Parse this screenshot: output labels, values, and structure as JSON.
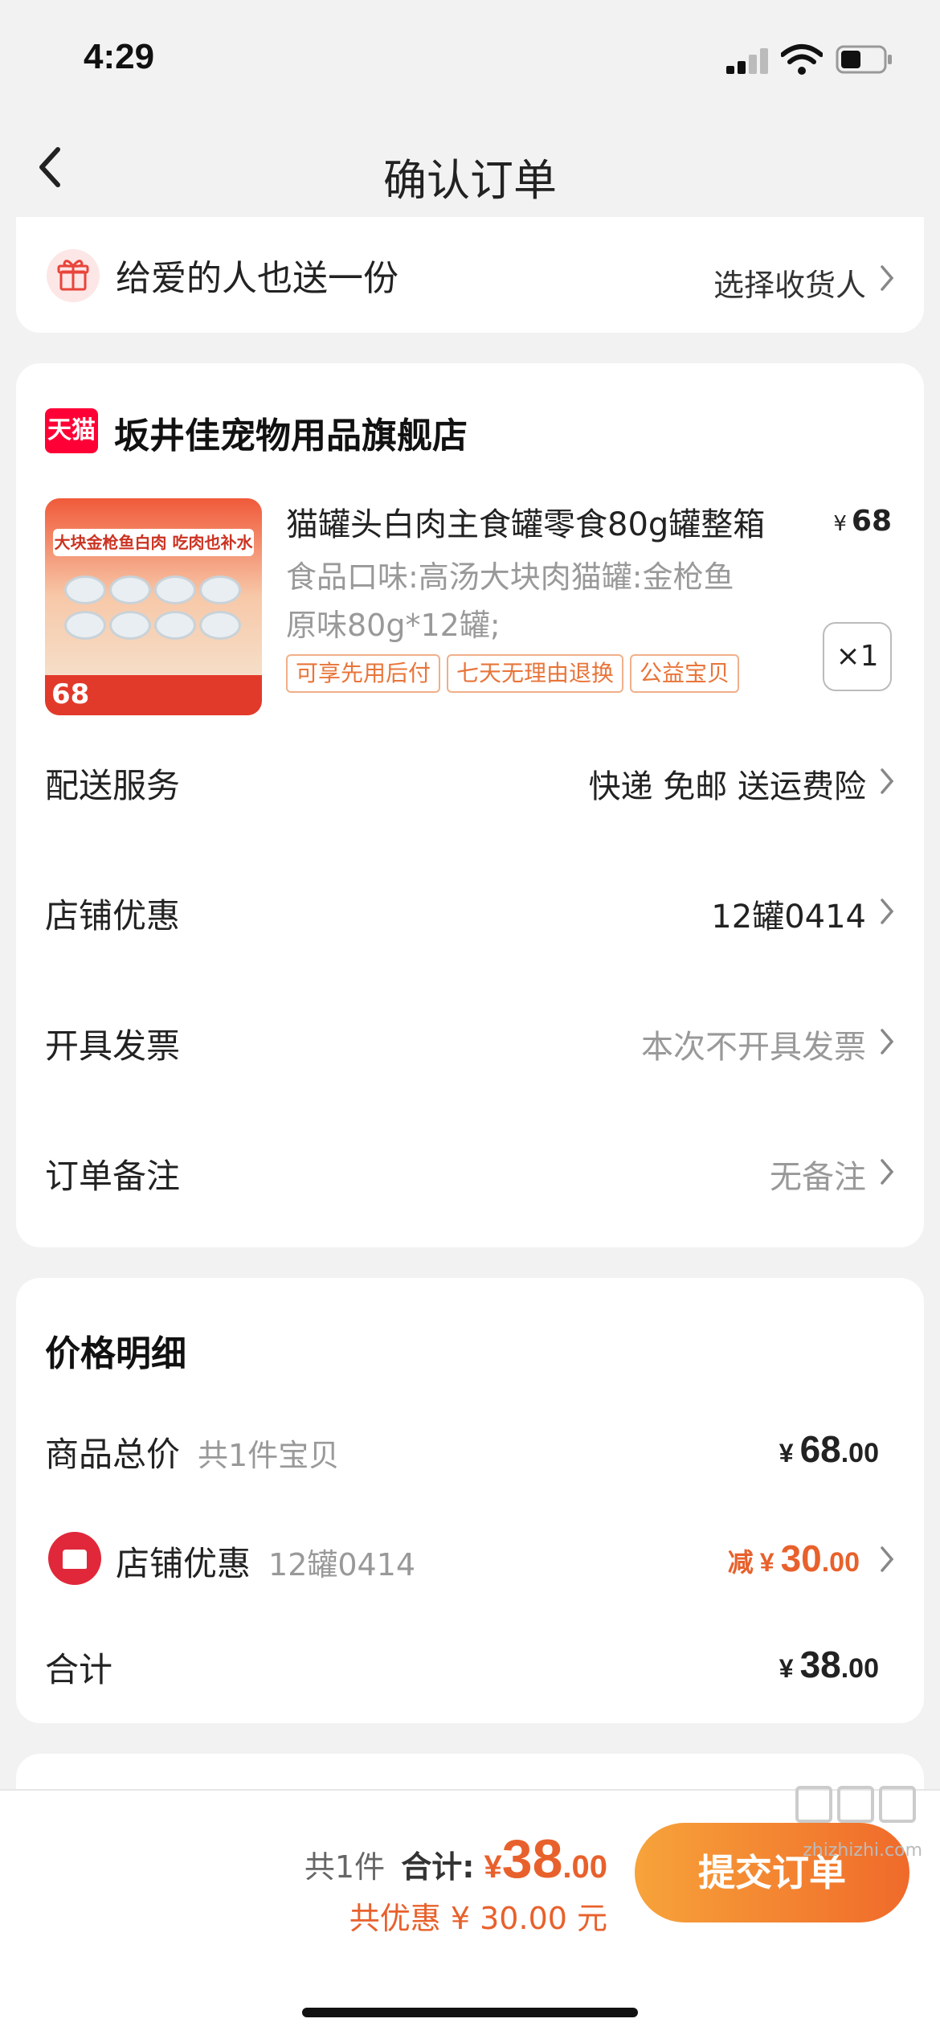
{
  "status_bar": {
    "time": "4:29"
  },
  "nav": {
    "title": "确认订单"
  },
  "gift": {
    "text": "给爱的人也送一份",
    "action": "选择收货人"
  },
  "store": {
    "badge": "天猫",
    "name": "坂井佳宠物用品旗舰店",
    "product": {
      "image_banner": "大块金枪鱼白肉 吃肉也补水",
      "image_price": "68",
      "title": "猫罐头白肉主食罐零食80g罐整箱",
      "price_currency": "¥",
      "price": "68",
      "spec_line1": "食品口味:高汤大块肉猫罐:金枪鱼",
      "spec_line2": "原味80g*12罐;",
      "tags": [
        "可享先用后付",
        "七天无理由退换",
        "公益宝贝"
      ],
      "quantity": "×1"
    },
    "rows": [
      {
        "label": "配送服务",
        "value": "快递 免邮 送运费险"
      },
      {
        "label": "店铺优惠",
        "value": "12罐0414"
      },
      {
        "label": "开具发票",
        "value": "本次不开具发票"
      },
      {
        "label": "订单备注",
        "value": "无备注"
      }
    ]
  },
  "price_detail": {
    "heading": "价格明细",
    "goods_total": {
      "label": "商品总价",
      "sub": "共1件宝贝",
      "currency": "¥",
      "int": "68",
      "dec": ".00"
    },
    "shop_discount": {
      "label": "店铺优惠",
      "sub": "12罐0414",
      "prefix": "减",
      "currency": "¥",
      "int": "30",
      "dec": ".00"
    },
    "total": {
      "label": "合计",
      "currency": "¥",
      "int": "38",
      "dec": ".00"
    }
  },
  "bottom_bar": {
    "count": "共1件",
    "total_label": "合计:",
    "currency": "¥",
    "total_int": "38",
    "total_dec": ".00",
    "discount_text": "共优惠 ¥ 30.00 元",
    "submit_label": "提交订单"
  },
  "watermark": {
    "text": "zhizhizhi.com"
  }
}
